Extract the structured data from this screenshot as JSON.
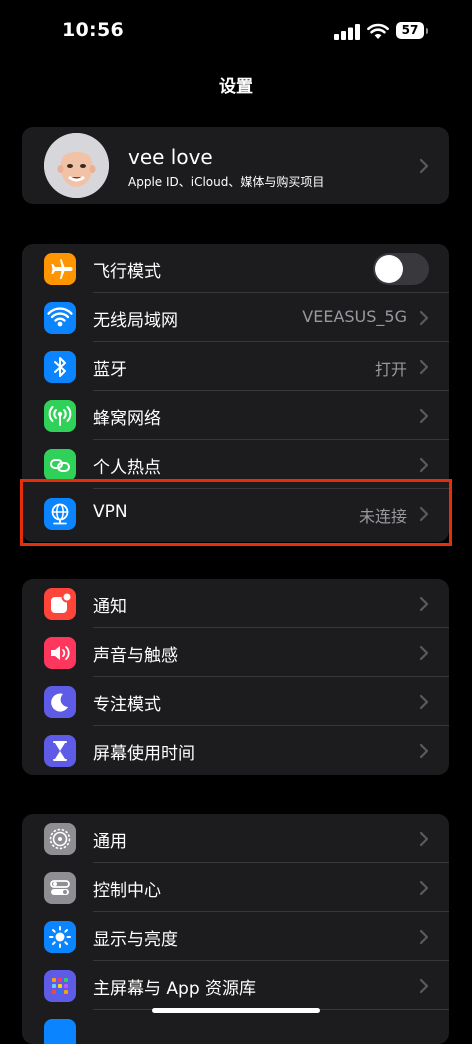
{
  "status_bar": {
    "time": "10:56",
    "battery": "57"
  },
  "header": {
    "title": "设置"
  },
  "profile": {
    "name": "vee love",
    "subtitle": "Apple ID、iCloud、媒体与购买项目"
  },
  "groups": {
    "connectivity": [
      {
        "label": "飞行模式",
        "icon": "airplane-icon",
        "color": "#ff9500",
        "toggle": false
      },
      {
        "label": "无线局域网",
        "icon": "wifi-icon",
        "color": "#0a84ff",
        "value": "VEEASUS_5G"
      },
      {
        "label": "蓝牙",
        "icon": "bluetooth-icon",
        "color": "#0a84ff",
        "value": "打开"
      },
      {
        "label": "蜂窝网络",
        "icon": "cellular-icon",
        "color": "#30d158"
      },
      {
        "label": "个人热点",
        "icon": "hotspot-icon",
        "color": "#30d158"
      },
      {
        "label": "VPN",
        "icon": "vpn-globe-icon",
        "color": "#0a84ff",
        "value": "未连接"
      }
    ],
    "notifications": [
      {
        "label": "通知",
        "icon": "bell-icon",
        "color": "#ff453a"
      },
      {
        "label": "声音与触感",
        "icon": "speaker-icon",
        "color": "#ff375f"
      },
      {
        "label": "专注模式",
        "icon": "moon-icon",
        "color": "#5e5ce6"
      },
      {
        "label": "屏幕使用时间",
        "icon": "hourglass-icon",
        "color": "#5e5ce6"
      }
    ],
    "general": [
      {
        "label": "通用",
        "icon": "gear-icon",
        "color": "#8e8e93"
      },
      {
        "label": "控制中心",
        "icon": "switches-icon",
        "color": "#8e8e93"
      },
      {
        "label": "显示与亮度",
        "icon": "sun-icon",
        "color": "#0a84ff"
      },
      {
        "label": "主屏幕与 App 资源库",
        "icon": "home-grid-icon",
        "color": "#5e5ce6"
      }
    ]
  },
  "colors": {
    "highlight_border": "#e62e0d",
    "group_bg": "#1c1c1e",
    "secondary_text": "#98989e"
  }
}
